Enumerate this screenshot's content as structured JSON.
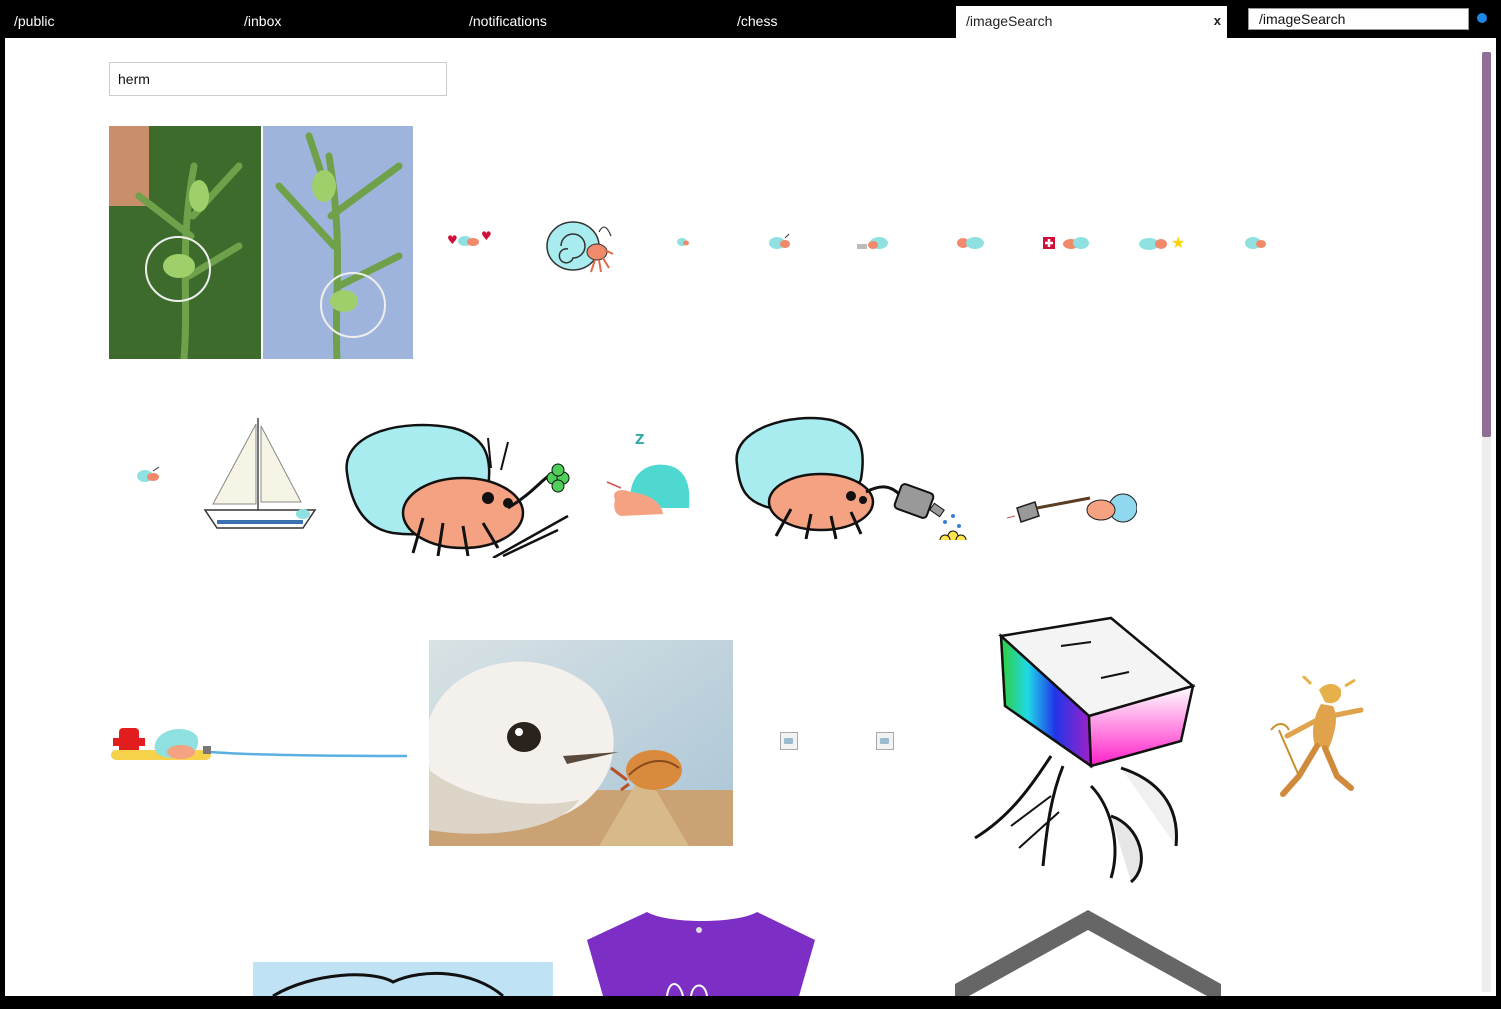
{
  "tabs": [
    {
      "label": "/public"
    },
    {
      "label": "/inbox"
    },
    {
      "label": "/notifications"
    },
    {
      "label": "/chess"
    },
    {
      "label": "/imageSearch",
      "close": "x"
    }
  ],
  "address": {
    "value": "/imageSearch"
  },
  "search": {
    "value": "herm"
  },
  "colors": {
    "scroll_thumb": "#8f6f95",
    "status_dot": "#1e88e5",
    "chrome": "#000000"
  },
  "results": [
    "plant-photo",
    "crab-hearts",
    "crab-spiral",
    "crab-tiny-1",
    "crab-tiny-2",
    "crab-laptop",
    "crab-group",
    "crab-medic",
    "crab-star",
    "crab-tiny-3",
    "crab-tiny-4",
    "sailboat",
    "crab-clover",
    "crab-sleep",
    "crab-watering",
    "crab-shovel",
    "crab-hydrant",
    "plover-photo",
    "broken-image-1",
    "broken-image-2",
    "crab-rgb-box",
    "hermes-figure",
    "crab-sketch",
    "purple-shirt",
    "house-outline"
  ]
}
